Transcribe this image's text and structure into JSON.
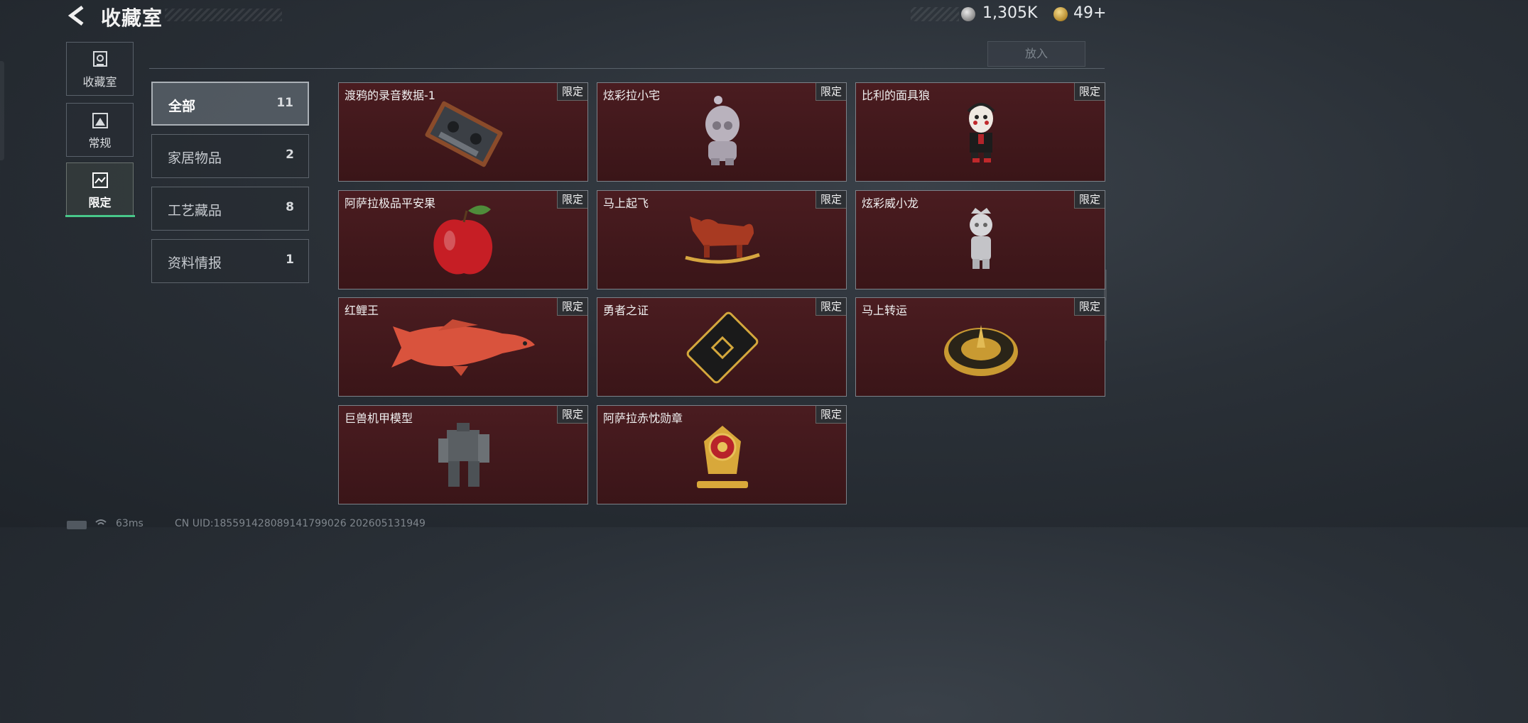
{
  "header": {
    "title": "收藏室",
    "currency_silver": "1,305K",
    "currency_gold": "49+",
    "place_button": "放入"
  },
  "nav": [
    {
      "label": "收藏室",
      "icon": "trophy-icon"
    },
    {
      "label": "常规",
      "icon": "picture-icon"
    },
    {
      "label": "限定",
      "icon": "image-frame-icon",
      "active": true
    }
  ],
  "categories": [
    {
      "name": "全部",
      "count": "11",
      "active": true
    },
    {
      "name": "家居物品",
      "count": "2"
    },
    {
      "name": "工艺藏品",
      "count": "8"
    },
    {
      "name": "资料情报",
      "count": "1"
    }
  ],
  "items": [
    {
      "name": "渡鸦的录音数据-1",
      "badge": "限定",
      "icon": "cassette-tape-icon"
    },
    {
      "name": "炫彩拉小宅",
      "badge": "限定",
      "icon": "figurine-icon"
    },
    {
      "name": "比利的面具狼",
      "badge": "限定",
      "icon": "puppet-doll-icon"
    },
    {
      "name": "阿萨拉极品平安果",
      "badge": "限定",
      "icon": "red-apple-icon"
    },
    {
      "name": "马上起飞",
      "badge": "限定",
      "icon": "rocking-horse-icon"
    },
    {
      "name": "炫彩威小龙",
      "badge": "限定",
      "icon": "dragon-figurine-icon"
    },
    {
      "name": "红鲤王",
      "badge": "限定",
      "icon": "koi-fish-icon"
    },
    {
      "name": "勇者之证",
      "badge": "限定",
      "icon": "gold-card-icon"
    },
    {
      "name": "马上转运",
      "badge": "限定",
      "icon": "gold-wheel-icon"
    },
    {
      "name": "巨兽机甲模型",
      "badge": "限定",
      "icon": "mech-model-icon"
    },
    {
      "name": "阿萨拉赤忱勋章",
      "badge": "限定",
      "icon": "gold-medal-icon"
    }
  ],
  "status": {
    "ping": "63ms",
    "uid": "CN UID:1855914280891417990​26 202605131949"
  },
  "colors": {
    "card_bg": "#3e171a",
    "active_tab_accent": "#48c78a",
    "badge_bg": "#2d2f33"
  }
}
